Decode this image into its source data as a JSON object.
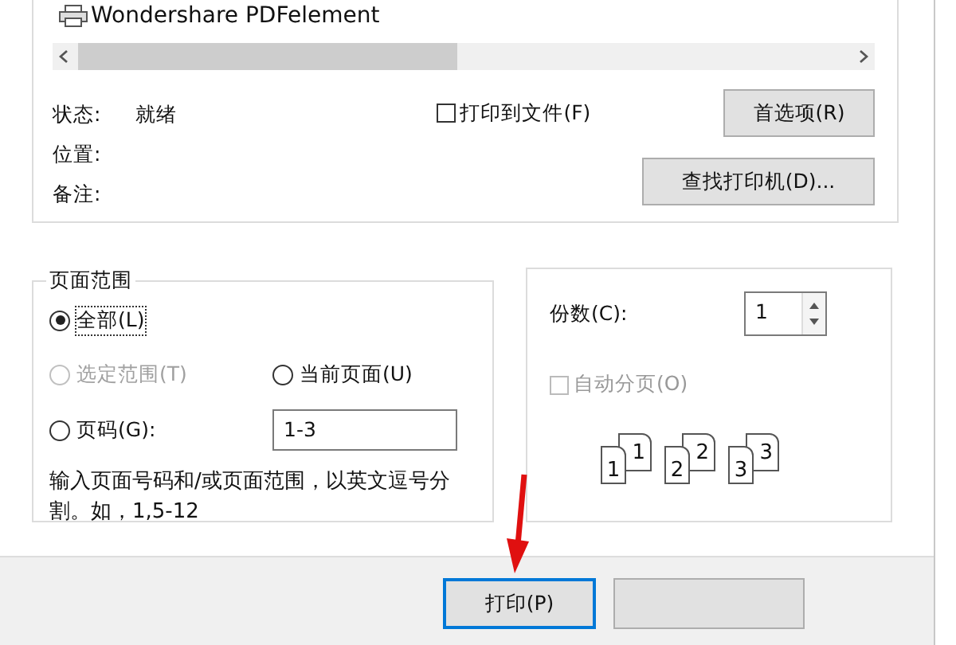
{
  "printer_list": {
    "items": [
      {
        "name": "Wondershare PDFelement"
      }
    ]
  },
  "printer_info": {
    "fields": [
      {
        "label": "状态:",
        "value": "就绪"
      },
      {
        "label": "位置:"
      },
      {
        "label": "备注:"
      }
    ],
    "print_to_file": {
      "label": "打印到文件(F)",
      "checked": false
    },
    "buttons": [
      "首选项(R)",
      "查找打印机(D)..."
    ]
  },
  "page_range": {
    "title": "页面范围",
    "options": [
      {
        "label": "全部(L)",
        "selected": true,
        "disabled": false
      },
      {
        "label": "选定范围(T)",
        "selected": false,
        "disabled": true
      },
      {
        "label": "当前页面(U)",
        "selected": false,
        "disabled": false
      },
      {
        "label": "页码(G):",
        "selected": false,
        "disabled": false
      }
    ],
    "pages_value": "1-3",
    "hint": "输入页面号码和/或页面范围，以英文逗号分割。如，1,5-12"
  },
  "copies": {
    "label": "份数(C):",
    "value": "1",
    "collate": {
      "label": "自动分页(O)",
      "checked": false,
      "disabled": true
    },
    "collate_icons": [
      {
        "front": "1",
        "back": "1"
      },
      {
        "front": "2",
        "back": "2"
      },
      {
        "front": "3",
        "back": "3"
      }
    ]
  },
  "footer": {
    "buttons": [
      {
        "label": "打印(P)",
        "default": true
      }
    ]
  }
}
